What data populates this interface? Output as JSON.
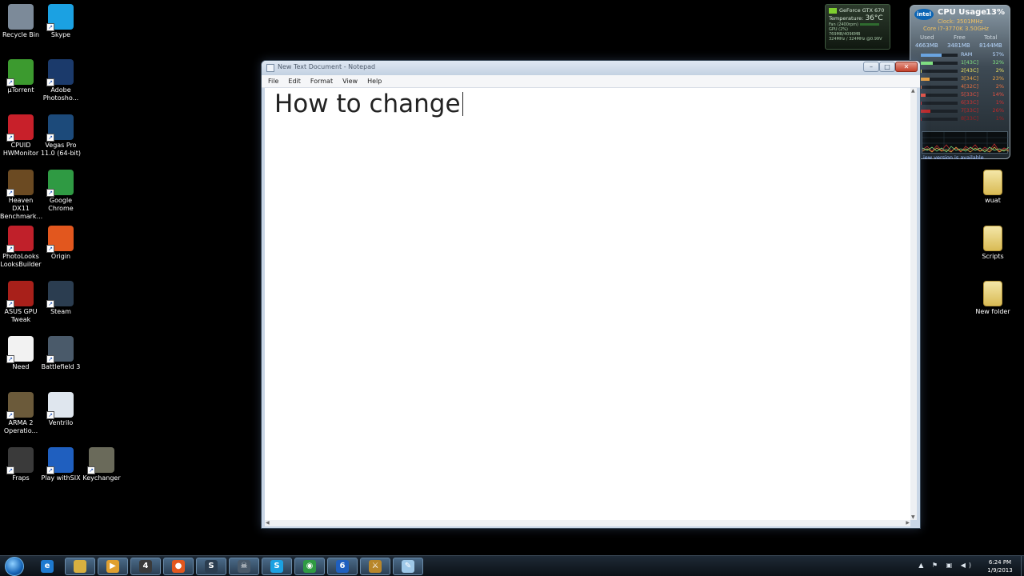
{
  "desktop": {
    "left_icons": [
      {
        "label": "Recycle Bin",
        "icon": "recycle-bin-icon",
        "color": "#7c8a99"
      },
      {
        "label": "Skype",
        "icon": "skype-icon",
        "color": "#1ba1e2"
      },
      {
        "label": "µTorrent",
        "icon": "utorrent-icon",
        "color": "#3c9a2f"
      },
      {
        "label": "Adobe Photosho...",
        "icon": "photoshop-icon",
        "color": "#1b3a6b"
      },
      {
        "label": "CPUID HWMonitor",
        "icon": "hwmonitor-icon",
        "color": "#c8202a"
      },
      {
        "label": "Vegas Pro 11.0 (64-bit)",
        "icon": "vegas-icon",
        "color": "#1c4a7a"
      },
      {
        "label": "Heaven DX11 Benchmark...",
        "icon": "heaven-icon",
        "color": "#6b4a22"
      },
      {
        "label": "Google Chrome",
        "icon": "chrome-icon",
        "color": "#2f9a43"
      },
      {
        "label": "PhotoLooks LooksBuilder",
        "icon": "photolooks-icon",
        "color": "#c0202a"
      },
      {
        "label": "Origin",
        "icon": "origin-icon",
        "color": "#e2571e"
      },
      {
        "label": "ASUS GPU Tweak",
        "icon": "asus-gpu-tweak-icon",
        "color": "#a8201a"
      },
      {
        "label": "Steam",
        "icon": "steam-icon",
        "color": "#2b3d50"
      },
      {
        "label": "Need",
        "icon": "text-file-icon",
        "color": "#f2f2f2"
      },
      {
        "label": "Battlefield 3",
        "icon": "battlefield-icon",
        "color": "#4a5a6a"
      },
      {
        "label": "ARMA 2 Operatio...",
        "icon": "arma-icon",
        "color": "#6b5a3a"
      },
      {
        "label": "Ventrilo",
        "icon": "ventrilo-icon",
        "color": "#dfe6ee"
      },
      {
        "label": "Fraps",
        "icon": "fraps-icon",
        "color": "#3a3a3a"
      },
      {
        "label": "Play withSIX",
        "icon": "playwithsix-icon",
        "color": "#1f5fbf"
      },
      {
        "label": "Keychanger",
        "icon": "keychanger-icon",
        "color": "#6a6a5a"
      }
    ],
    "right_icons": [
      {
        "label": "wuat",
        "icon": "folder-icon"
      },
      {
        "label": "Scripts",
        "icon": "folder-icon"
      },
      {
        "label": "New folder",
        "icon": "folder-icon"
      }
    ]
  },
  "notepad": {
    "title": "New Text Document - Notepad",
    "menu": [
      "File",
      "Edit",
      "Format",
      "View",
      "Help"
    ],
    "content": "How to change"
  },
  "gpu_gadget": {
    "name": "GeForce GTX 670",
    "temperature_label": "Temperature:",
    "temperature": "36°C",
    "fan": "Fan (2400rpm)",
    "gpu": "GPU (2%)",
    "memory": "769MB/4096MB",
    "clocks": "324MHz / 324MHz @0.99V"
  },
  "cpu_gadget": {
    "title": "CPU Usage",
    "usage": "13%",
    "clock": "Clock: 3501MHz",
    "model": "Core i7-3770K 3.50GHz",
    "mem_headers": [
      "Used",
      "Free",
      "Total"
    ],
    "mem_values": [
      "4663MB",
      "3481MB",
      "8144MB"
    ],
    "ram_label": "RAM",
    "ram_pct": "57%",
    "ram_fraction": 0.57,
    "cores": [
      {
        "name": "1[43C]",
        "pct": "32%",
        "fraction": 0.32,
        "color": "#7fe07f"
      },
      {
        "name": "2[43C]",
        "pct": "2%",
        "fraction": 0.02,
        "color": "#e8e060"
      },
      {
        "name": "3[34C]",
        "pct": "23%",
        "fraction": 0.23,
        "color": "#e8a040"
      },
      {
        "name": "4[32C]",
        "pct": "2%",
        "fraction": 0.02,
        "color": "#e87040"
      },
      {
        "name": "5[33C]",
        "pct": "14%",
        "fraction": 0.14,
        "color": "#e85040"
      },
      {
        "name": "6[33C]",
        "pct": "1%",
        "fraction": 0.01,
        "color": "#d03030"
      },
      {
        "name": "7[33C]",
        "pct": "26%",
        "fraction": 0.26,
        "color": "#c02828"
      },
      {
        "name": "8[33C]",
        "pct": "1%",
        "fraction": 0.01,
        "color": "#a02020"
      }
    ],
    "update_text": "iew version is available"
  },
  "taskbar": {
    "items": [
      {
        "name": "taskbar-ie",
        "icon": "internet-explorer-icon",
        "color": "#1e7ad0",
        "glyph": "e"
      },
      {
        "name": "taskbar-explorer",
        "icon": "folder-icon",
        "color": "#d8b040",
        "glyph": ""
      },
      {
        "name": "taskbar-media",
        "icon": "media-player-icon",
        "color": "#e0a030",
        "glyph": "▶"
      },
      {
        "name": "taskbar-app4",
        "icon": "app-4-icon",
        "color": "#3a3a3a",
        "glyph": "4"
      },
      {
        "name": "taskbar-origin",
        "icon": "origin-icon",
        "color": "#e2571e",
        "glyph": "●"
      },
      {
        "name": "taskbar-steam",
        "icon": "steam-icon",
        "color": "#2b3d50",
        "glyph": "S"
      },
      {
        "name": "taskbar-bf3",
        "icon": "battlefield-icon",
        "color": "#4a5a6a",
        "glyph": "☠"
      },
      {
        "name": "taskbar-skype",
        "icon": "skype-icon",
        "color": "#1ba1e2",
        "glyph": "S"
      },
      {
        "name": "taskbar-chrome",
        "icon": "chrome-icon",
        "color": "#2f9a43",
        "glyph": "◉"
      },
      {
        "name": "taskbar-playwithsix",
        "icon": "playwithsix-icon",
        "color": "#1f5fbf",
        "glyph": "6"
      },
      {
        "name": "taskbar-arma",
        "icon": "arma-icon",
        "color": "#b8862a",
        "glyph": "⚔"
      },
      {
        "name": "taskbar-notepad",
        "icon": "notepad-icon",
        "color": "#9ec8e8",
        "glyph": "✎"
      }
    ],
    "tray": "▲ ⚑ ▣ ◀)",
    "time": "6:24 PM",
    "date": "1/9/2013"
  }
}
